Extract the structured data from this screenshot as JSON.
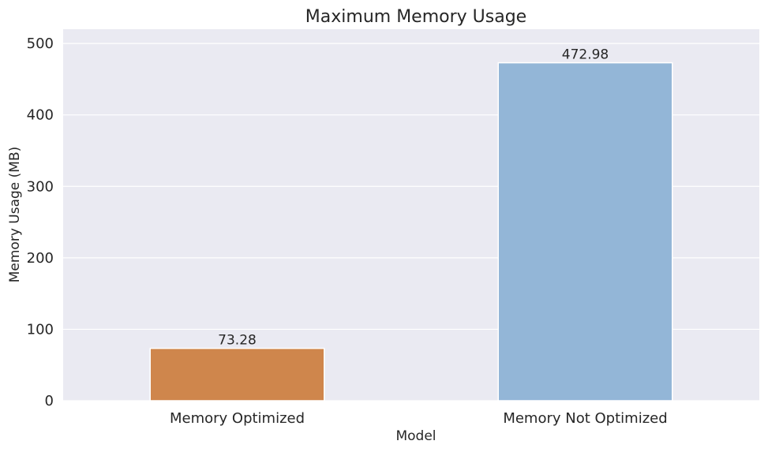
{
  "chart_data": {
    "type": "bar",
    "title": "Maximum Memory Usage",
    "xlabel": "Model",
    "ylabel": "Memory Usage (MB)",
    "categories": [
      "Memory Optimized",
      "Memory Not Optimized"
    ],
    "values": [
      73.28,
      472.98
    ],
    "value_labels": [
      "73.28",
      "472.98"
    ],
    "colors": [
      "#cf864c",
      "#93b6d7"
    ],
    "ylim": [
      0,
      520
    ],
    "yticks": [
      0,
      100,
      200,
      300,
      400,
      500
    ],
    "ytick_labels": [
      "0",
      "100",
      "200",
      "300",
      "400",
      "500"
    ],
    "grid": true,
    "background_color": "#eaeaf2",
    "legend": "none"
  }
}
